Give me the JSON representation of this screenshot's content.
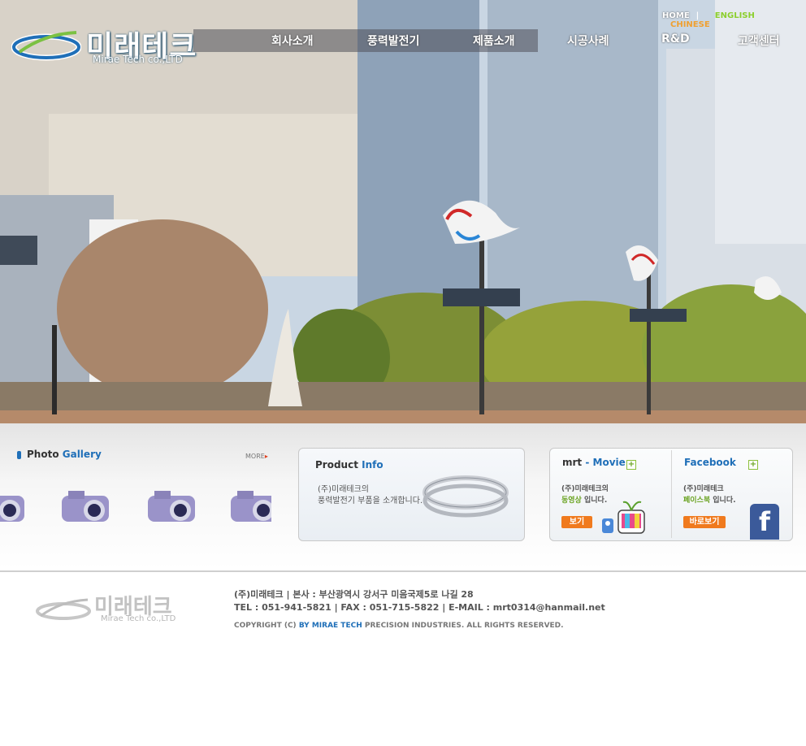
{
  "brand": {
    "name_kr": "미래테크",
    "name_en": "Mirae Tech co.,LTD"
  },
  "top_links": [
    {
      "label": "HOME",
      "color": "#ffffff"
    },
    {
      "label": "ENGLISH",
      "color": "#8ccf2e"
    },
    {
      "label": "CHINESE",
      "color": "#f0a030"
    }
  ],
  "nav": [
    "회사소개",
    "풍력발전기",
    "제품소개",
    "시공사례",
    "R&D",
    "고객센터"
  ],
  "gallery": {
    "title_a": "Photo",
    "title_b": "Gallery",
    "more": "MORE"
  },
  "product": {
    "title_a": "Product",
    "title_b": "Info",
    "line1": "(주)미래테크의",
    "line2": "풍력발전기 부품을 소개합니다."
  },
  "movie": {
    "title_a": "mrt",
    "title_b": "- Movie",
    "line1": "(주)미래테크의",
    "line2_highlight": "동영상",
    "line2_rest": " 입니다.",
    "button": "보기"
  },
  "facebook": {
    "title": "Facebook",
    "line1": "(주)미래테크",
    "line2_highlight": "페이스북",
    "line2_rest": " 입니다.",
    "button": "바로보기"
  },
  "footer": {
    "logo_kr": "미래테크",
    "logo_en": "Mirae Tech co.,LTD",
    "address": "(주)미래테크 | 본사 : 부산광역시 강서구 미음국제5로 나길 28",
    "contact": "TEL : 051-941-5821 | FAX : 051-715-5822 | E-MAIL : mrt0314@hanmail.net",
    "copyright_a": "COPYRIGHT (C)",
    "copyright_b": "BY MIRAE TECH",
    "copyright_c": "PRECISION INDUSTRIES. ALL RIGHTS RESERVED."
  },
  "colors": {
    "accent_blue": "#1f6fb8",
    "button_orange": "#f07a1e",
    "plus_green": "#6aa321"
  }
}
